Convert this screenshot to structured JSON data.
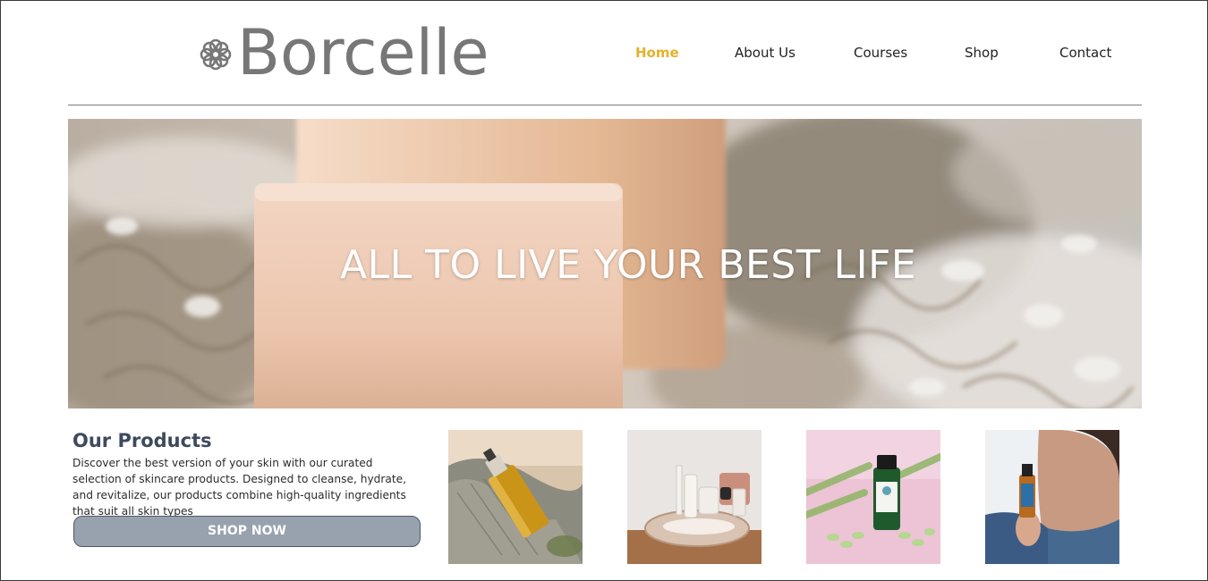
{
  "header": {
    "brand": "Borcelle",
    "nav": [
      {
        "label": "Home",
        "active": true
      },
      {
        "label": "About Us",
        "active": false
      },
      {
        "label": "Courses",
        "active": false
      },
      {
        "label": "Shop",
        "active": false
      },
      {
        "label": "Contact",
        "active": false
      }
    ]
  },
  "hero": {
    "headline": "ALL TO LIVE YOUR BEST LIFE"
  },
  "products": {
    "title": "Our Products",
    "description": "Discover the best version of your skin with our curated selection of skincare products. Designed to cleanse, hydrate, and revitalize, our products combine high-quality ingredients that suit all skin types",
    "cta_label": "SHOP NOW",
    "images": [
      {
        "name": "oil-bottle-on-towel-image"
      },
      {
        "name": "cosmetics-tray-image"
      },
      {
        "name": "essential-oil-lemongrass-image"
      },
      {
        "name": "woman-holding-oil-image"
      }
    ]
  },
  "colors": {
    "accent": "#e6b12b",
    "brand_text": "#777777",
    "heading": "#3e4a5c",
    "button_bg": "#98a2ae"
  },
  "icons": {
    "logo": "flower-icon"
  }
}
